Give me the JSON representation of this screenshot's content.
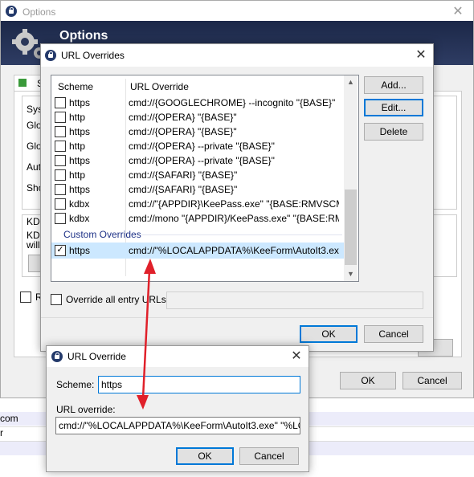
{
  "options_window": {
    "title": "Options",
    "header": "Options",
    "tab_label": "S",
    "left_labels": [
      "Syst",
      "Glob",
      "Glob",
      "Auto",
      "Sho"
    ],
    "kde_labels": [
      "KDE",
      "KDE",
      "will"
    ],
    "r_label": "R",
    "ok": "OK",
    "cancel": "Cancel"
  },
  "background_rows": [
    "com",
    "r"
  ],
  "url_overrides": {
    "title": "URL Overrides",
    "col_scheme": "Scheme",
    "col_override": "URL Override",
    "rows": [
      {
        "scheme": "https",
        "url": "cmd://{GOOGLECHROME} --incognito \"{BASE}\""
      },
      {
        "scheme": "http",
        "url": "cmd://{OPERA} \"{BASE}\""
      },
      {
        "scheme": "https",
        "url": "cmd://{OPERA} \"{BASE}\""
      },
      {
        "scheme": "http",
        "url": "cmd://{OPERA} --private \"{BASE}\""
      },
      {
        "scheme": "https",
        "url": "cmd://{OPERA} --private \"{BASE}\""
      },
      {
        "scheme": "http",
        "url": "cmd://{SAFARI} \"{BASE}\""
      },
      {
        "scheme": "https",
        "url": "cmd://{SAFARI} \"{BASE}\""
      },
      {
        "scheme": "kdbx",
        "url": "cmd://\"{APPDIR}\\KeePass.exe\" \"{BASE:RMVSCM..."
      },
      {
        "scheme": "kdbx",
        "url": "cmd://mono \"{APPDIR}/KeePass.exe\" \"{BASE:RM..."
      }
    ],
    "group_label": "Custom Overrides",
    "custom_row": {
      "scheme": "https",
      "url": "cmd://\"%LOCALAPPDATA%\\KeeForm\\AutoIt3.exe..."
    },
    "add": "Add...",
    "edit": "Edit...",
    "delete": "Delete",
    "override_all_label": "Override all entry URLs:",
    "ok": "OK",
    "cancel": "Cancel"
  },
  "url_override": {
    "title": "URL Override",
    "scheme_label": "Scheme:",
    "scheme_value": "https",
    "override_label": "URL override:",
    "override_value": "cmd://\"%LOCALAPPDATA%\\KeeForm\\AutoIt3.exe\" \"%LOCAL",
    "ok": "OK",
    "cancel": "Cancel"
  },
  "colors": {
    "arrow": "#e0202a",
    "selection": "#cce8ff",
    "banner": "#1e2a4a"
  }
}
